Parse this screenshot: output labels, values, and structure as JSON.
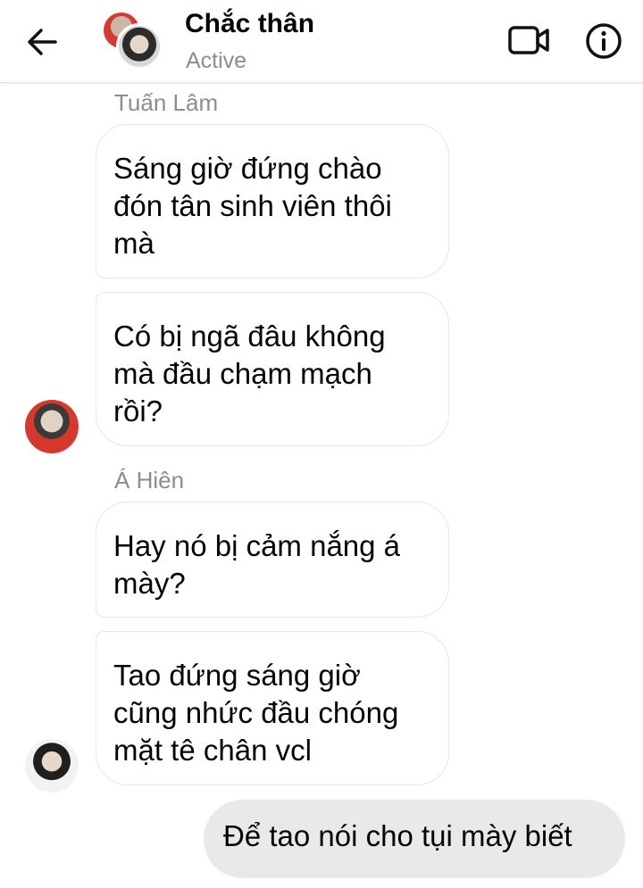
{
  "header": {
    "title": "Chắc thân",
    "status": "Active",
    "icons": {
      "back": "arrow-left-icon",
      "video": "video-camera-icon",
      "info": "info-icon"
    }
  },
  "messages": [
    {
      "sender": "Tuấn Lâm",
      "lines": [
        "Sáng giờ đứng chào",
        "đón tân sinh viên thôi",
        "mà"
      ]
    },
    {
      "lines": [
        "Có bị ngã đâu không",
        "mà đầu chạm mạch",
        "rồi?"
      ]
    },
    {
      "sender": "Á Hiên",
      "lines": [
        "Hay nó bị cảm nắng á",
        "mày?"
      ]
    },
    {
      "lines": [
        "Tao đứng sáng giờ",
        "cũng nhức đầu chóng",
        "mặt tê chân vcl"
      ]
    },
    {
      "outgoing": true,
      "lines": [
        "Để tao nói cho tụi mày biết"
      ]
    }
  ],
  "colors": {
    "outgoing_bubble": "#e9e9eb",
    "border": "#e4e6eb",
    "muted_text": "#8a8d91"
  }
}
